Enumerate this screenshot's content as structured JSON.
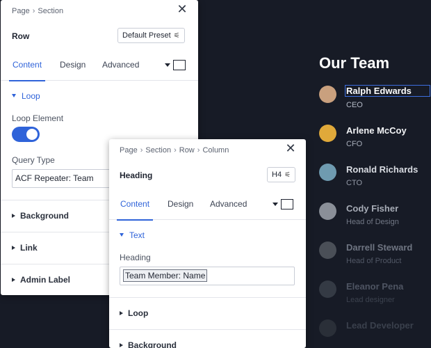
{
  "team": {
    "title": "Our Team",
    "members": [
      {
        "name": "Ralph Edwards",
        "role": "CEO",
        "avatar_color": "#c9a07e",
        "name_color": "#ffffff",
        "role_color": "#b6bcc8"
      },
      {
        "name": "Arlene McCoy",
        "role": "CFO",
        "avatar_color": "#e0a93a",
        "name_color": "#f2f3f5",
        "role_color": "#a9afbb"
      },
      {
        "name": "Ronald Richards",
        "role": "CTO",
        "avatar_color": "#6f9bb0",
        "name_color": "#d9dce2",
        "role_color": "#949aa7"
      },
      {
        "name": "Cody Fisher",
        "role": "Head of Design",
        "avatar_color": "#8a8f98",
        "name_color": "#a7acb6",
        "role_color": "#727885"
      },
      {
        "name": "Darrell Steward",
        "role": "Head of Product",
        "avatar_color": "#4a4f57",
        "name_color": "#6f7582",
        "role_color": "#525866"
      },
      {
        "name": "Eleanor Pena",
        "role": "Lead designer",
        "avatar_color": "#343a44",
        "name_color": "#4e5462",
        "role_color": "#3c424e"
      },
      {
        "name": "Lead Developer",
        "role": "",
        "avatar_color": "#2a2f38",
        "name_color": "#3a404c",
        "role_color": "#2f343e"
      }
    ]
  },
  "panel_section": {
    "breadcrumb": [
      "Page",
      "Section"
    ],
    "element_title": "Row",
    "preset_label": "Default Preset",
    "tabs": [
      {
        "label": "Content",
        "active": true
      },
      {
        "label": "Design",
        "active": false
      },
      {
        "label": "Advanced",
        "active": false
      }
    ],
    "open_section": "Loop",
    "loop_element_label": "Loop Element",
    "loop_element_on": true,
    "query_type_label": "Query Type",
    "query_type_value": "ACF Repeater: Team",
    "collapsed_sections": [
      "Background",
      "Link",
      "Admin Label"
    ]
  },
  "panel_column": {
    "breadcrumb": [
      "Page",
      "Section",
      "Row",
      "Column"
    ],
    "element_title": "Heading",
    "tag_label": "H4",
    "tabs": [
      {
        "label": "Content",
        "active": true
      },
      {
        "label": "Design",
        "active": false
      },
      {
        "label": "Advanced",
        "active": false
      }
    ],
    "open_section": "Text",
    "heading_label": "Heading",
    "heading_value": "Team Member: Name",
    "collapsed_sections": [
      "Loop",
      "Background"
    ]
  },
  "icons": {
    "close": "close-icon",
    "breadcrumb_separator": "chevron-right-icon",
    "preset_tune": "sliders-icon",
    "tab_menu": "panel-toggle-icon"
  },
  "colors": {
    "accent": "#2f63d9",
    "page_background": "#171b26"
  }
}
